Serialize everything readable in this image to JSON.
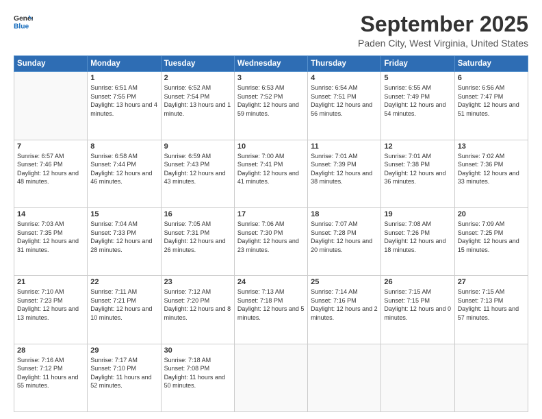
{
  "logo": {
    "line1": "General",
    "line2": "Blue"
  },
  "header": {
    "month": "September 2025",
    "location": "Paden City, West Virginia, United States"
  },
  "weekdays": [
    "Sunday",
    "Monday",
    "Tuesday",
    "Wednesday",
    "Thursday",
    "Friday",
    "Saturday"
  ],
  "weeks": [
    [
      {
        "day": "",
        "sunrise": "",
        "sunset": "",
        "daylight": ""
      },
      {
        "day": "1",
        "sunrise": "Sunrise: 6:51 AM",
        "sunset": "Sunset: 7:55 PM",
        "daylight": "Daylight: 13 hours and 4 minutes."
      },
      {
        "day": "2",
        "sunrise": "Sunrise: 6:52 AM",
        "sunset": "Sunset: 7:54 PM",
        "daylight": "Daylight: 13 hours and 1 minute."
      },
      {
        "day": "3",
        "sunrise": "Sunrise: 6:53 AM",
        "sunset": "Sunset: 7:52 PM",
        "daylight": "Daylight: 12 hours and 59 minutes."
      },
      {
        "day": "4",
        "sunrise": "Sunrise: 6:54 AM",
        "sunset": "Sunset: 7:51 PM",
        "daylight": "Daylight: 12 hours and 56 minutes."
      },
      {
        "day": "5",
        "sunrise": "Sunrise: 6:55 AM",
        "sunset": "Sunset: 7:49 PM",
        "daylight": "Daylight: 12 hours and 54 minutes."
      },
      {
        "day": "6",
        "sunrise": "Sunrise: 6:56 AM",
        "sunset": "Sunset: 7:47 PM",
        "daylight": "Daylight: 12 hours and 51 minutes."
      }
    ],
    [
      {
        "day": "7",
        "sunrise": "Sunrise: 6:57 AM",
        "sunset": "Sunset: 7:46 PM",
        "daylight": "Daylight: 12 hours and 48 minutes."
      },
      {
        "day": "8",
        "sunrise": "Sunrise: 6:58 AM",
        "sunset": "Sunset: 7:44 PM",
        "daylight": "Daylight: 12 hours and 46 minutes."
      },
      {
        "day": "9",
        "sunrise": "Sunrise: 6:59 AM",
        "sunset": "Sunset: 7:43 PM",
        "daylight": "Daylight: 12 hours and 43 minutes."
      },
      {
        "day": "10",
        "sunrise": "Sunrise: 7:00 AM",
        "sunset": "Sunset: 7:41 PM",
        "daylight": "Daylight: 12 hours and 41 minutes."
      },
      {
        "day": "11",
        "sunrise": "Sunrise: 7:01 AM",
        "sunset": "Sunset: 7:39 PM",
        "daylight": "Daylight: 12 hours and 38 minutes."
      },
      {
        "day": "12",
        "sunrise": "Sunrise: 7:01 AM",
        "sunset": "Sunset: 7:38 PM",
        "daylight": "Daylight: 12 hours and 36 minutes."
      },
      {
        "day": "13",
        "sunrise": "Sunrise: 7:02 AM",
        "sunset": "Sunset: 7:36 PM",
        "daylight": "Daylight: 12 hours and 33 minutes."
      }
    ],
    [
      {
        "day": "14",
        "sunrise": "Sunrise: 7:03 AM",
        "sunset": "Sunset: 7:35 PM",
        "daylight": "Daylight: 12 hours and 31 minutes."
      },
      {
        "day": "15",
        "sunrise": "Sunrise: 7:04 AM",
        "sunset": "Sunset: 7:33 PM",
        "daylight": "Daylight: 12 hours and 28 minutes."
      },
      {
        "day": "16",
        "sunrise": "Sunrise: 7:05 AM",
        "sunset": "Sunset: 7:31 PM",
        "daylight": "Daylight: 12 hours and 26 minutes."
      },
      {
        "day": "17",
        "sunrise": "Sunrise: 7:06 AM",
        "sunset": "Sunset: 7:30 PM",
        "daylight": "Daylight: 12 hours and 23 minutes."
      },
      {
        "day": "18",
        "sunrise": "Sunrise: 7:07 AM",
        "sunset": "Sunset: 7:28 PM",
        "daylight": "Daylight: 12 hours and 20 minutes."
      },
      {
        "day": "19",
        "sunrise": "Sunrise: 7:08 AM",
        "sunset": "Sunset: 7:26 PM",
        "daylight": "Daylight: 12 hours and 18 minutes."
      },
      {
        "day": "20",
        "sunrise": "Sunrise: 7:09 AM",
        "sunset": "Sunset: 7:25 PM",
        "daylight": "Daylight: 12 hours and 15 minutes."
      }
    ],
    [
      {
        "day": "21",
        "sunrise": "Sunrise: 7:10 AM",
        "sunset": "Sunset: 7:23 PM",
        "daylight": "Daylight: 12 hours and 13 minutes."
      },
      {
        "day": "22",
        "sunrise": "Sunrise: 7:11 AM",
        "sunset": "Sunset: 7:21 PM",
        "daylight": "Daylight: 12 hours and 10 minutes."
      },
      {
        "day": "23",
        "sunrise": "Sunrise: 7:12 AM",
        "sunset": "Sunset: 7:20 PM",
        "daylight": "Daylight: 12 hours and 8 minutes."
      },
      {
        "day": "24",
        "sunrise": "Sunrise: 7:13 AM",
        "sunset": "Sunset: 7:18 PM",
        "daylight": "Daylight: 12 hours and 5 minutes."
      },
      {
        "day": "25",
        "sunrise": "Sunrise: 7:14 AM",
        "sunset": "Sunset: 7:16 PM",
        "daylight": "Daylight: 12 hours and 2 minutes."
      },
      {
        "day": "26",
        "sunrise": "Sunrise: 7:15 AM",
        "sunset": "Sunset: 7:15 PM",
        "daylight": "Daylight: 12 hours and 0 minutes."
      },
      {
        "day": "27",
        "sunrise": "Sunrise: 7:15 AM",
        "sunset": "Sunset: 7:13 PM",
        "daylight": "Daylight: 11 hours and 57 minutes."
      }
    ],
    [
      {
        "day": "28",
        "sunrise": "Sunrise: 7:16 AM",
        "sunset": "Sunset: 7:12 PM",
        "daylight": "Daylight: 11 hours and 55 minutes."
      },
      {
        "day": "29",
        "sunrise": "Sunrise: 7:17 AM",
        "sunset": "Sunset: 7:10 PM",
        "daylight": "Daylight: 11 hours and 52 minutes."
      },
      {
        "day": "30",
        "sunrise": "Sunrise: 7:18 AM",
        "sunset": "Sunset: 7:08 PM",
        "daylight": "Daylight: 11 hours and 50 minutes."
      },
      {
        "day": "",
        "sunrise": "",
        "sunset": "",
        "daylight": ""
      },
      {
        "day": "",
        "sunrise": "",
        "sunset": "",
        "daylight": ""
      },
      {
        "day": "",
        "sunrise": "",
        "sunset": "",
        "daylight": ""
      },
      {
        "day": "",
        "sunrise": "",
        "sunset": "",
        "daylight": ""
      }
    ]
  ]
}
